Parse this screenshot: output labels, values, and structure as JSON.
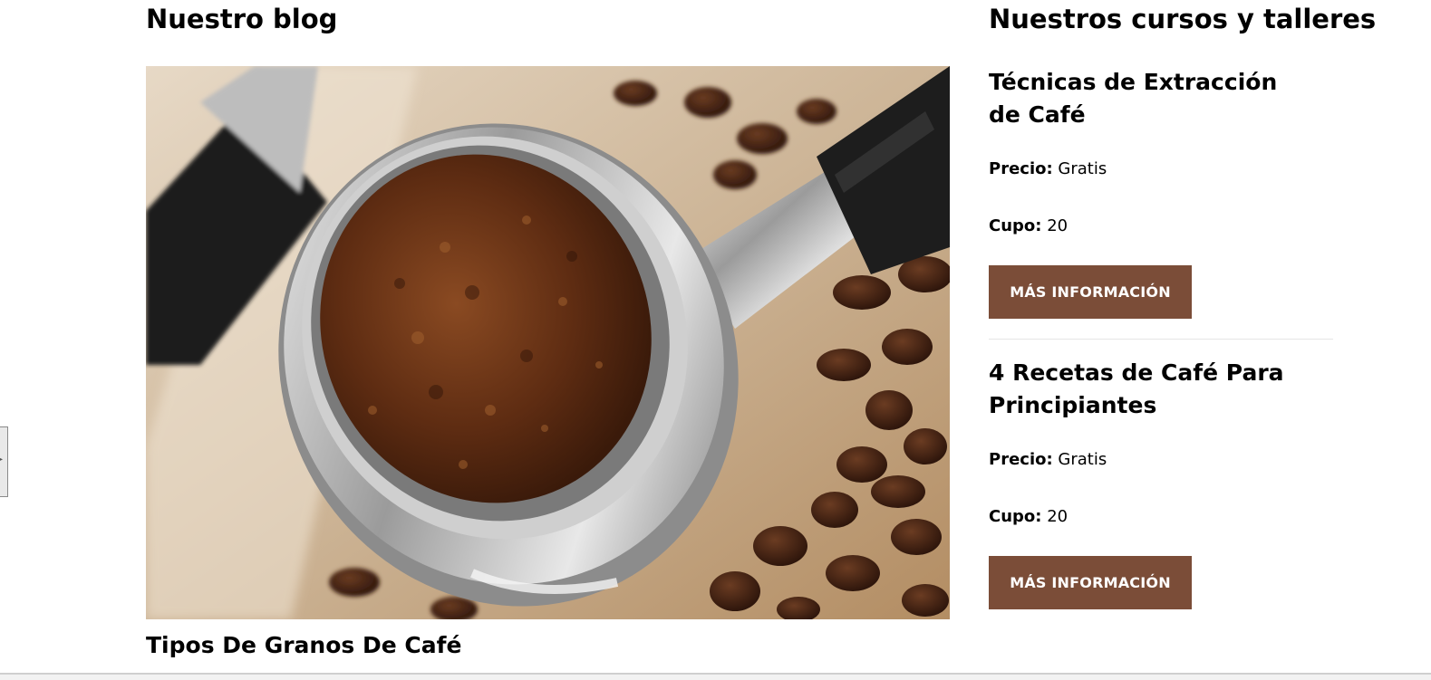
{
  "blog": {
    "heading": "Nuestro blog",
    "post_title": "Tipos De Granos De Café",
    "image_subject": "espresso-portafilter-with-ground-coffee-and-beans"
  },
  "courses": {
    "heading": "Nuestros cursos y talleres",
    "items": [
      {
        "name": "Técnicas de Extracción de Café",
        "price_label": "Precio:",
        "price_value": "Gratis",
        "cupo_label": "Cupo:",
        "cupo_value": "20",
        "button_label": "MÁS INFORMACIÓN"
      },
      {
        "name": "4 Recetas de Café Para Principiantes",
        "price_label": "Precio:",
        "price_value": "Gratis",
        "cupo_label": "Cupo:",
        "cupo_value": "20",
        "button_label": "MÁS INFORMACIÓN"
      }
    ]
  },
  "colors": {
    "button_bg": "#7b4d38",
    "button_text": "#ffffff",
    "text": "#000000"
  }
}
